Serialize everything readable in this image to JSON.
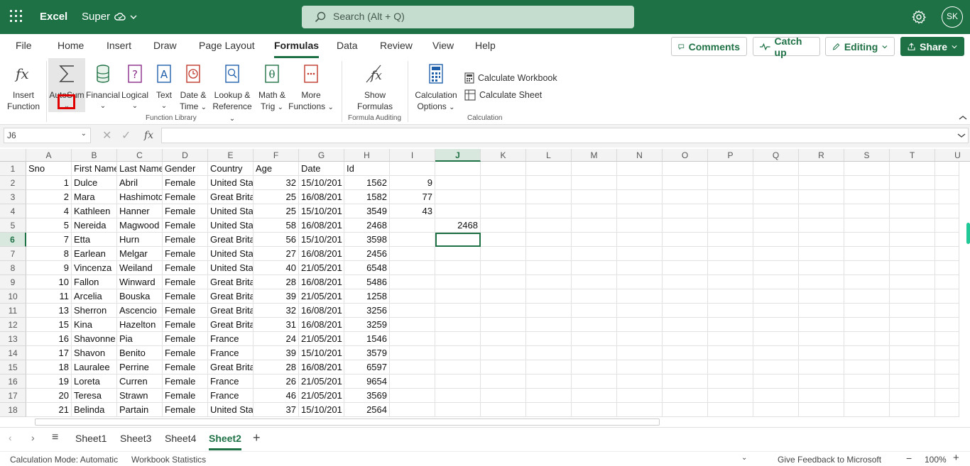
{
  "app": {
    "name": "Excel",
    "doc": "Super",
    "search_placeholder": "Search (Alt + Q)",
    "user": "SK"
  },
  "menu": [
    "File",
    "Home",
    "Insert",
    "Draw",
    "Page Layout",
    "Formulas",
    "Data",
    "Review",
    "View",
    "Help"
  ],
  "actions": {
    "comments": "Comments",
    "catchup": "Catch up",
    "editing": "Editing",
    "share": "Share"
  },
  "ribbon": {
    "insert_function": [
      "Insert",
      "Function"
    ],
    "autosum": "AutoSum",
    "financial": "Financial",
    "logical": "Logical",
    "text": "Text",
    "datetime": [
      "Date &",
      "Time"
    ],
    "lookup": [
      "Lookup &",
      "Reference"
    ],
    "math": [
      "Math &",
      "Trig"
    ],
    "more": [
      "More",
      "Functions"
    ],
    "show_formulas": [
      "Show",
      "Formulas"
    ],
    "calc_options": [
      "Calculation",
      "Options"
    ],
    "calc_workbook": "Calculate Workbook",
    "calc_sheet": "Calculate Sheet",
    "groups": {
      "function_library": "Function Library",
      "formula_auditing": "Formula Auditing",
      "calculation": "Calculation"
    }
  },
  "formula_bar": {
    "name_box": "J6",
    "formula": ""
  },
  "grid": {
    "columns": [
      "A",
      "B",
      "C",
      "D",
      "E",
      "F",
      "G",
      "H",
      "I",
      "J",
      "K",
      "L",
      "M",
      "N",
      "O",
      "P",
      "Q",
      "R",
      "S",
      "T",
      "U"
    ],
    "rows": [
      1,
      2,
      3,
      4,
      5,
      6,
      7,
      8,
      9,
      10,
      11,
      12,
      13,
      14,
      15,
      16,
      17,
      18
    ],
    "selected": "J6",
    "data": [
      [
        "Sno",
        "First Name",
        "Last Name",
        "Gender",
        "Country",
        "Age",
        "Date",
        "Id",
        "",
        ""
      ],
      [
        "1",
        "Dulce",
        "Abril",
        "Female",
        "United Sta",
        "32",
        "15/10/201",
        "1562",
        "9",
        ""
      ],
      [
        "2",
        "Mara",
        "Hashimoto",
        "Female",
        "Great Brita",
        "25",
        "16/08/201",
        "1582",
        "77",
        ""
      ],
      [
        "4",
        "Kathleen",
        "Hanner",
        "Female",
        "United Sta",
        "25",
        "15/10/201",
        "3549",
        "43",
        ""
      ],
      [
        "5",
        "Nereida",
        "Magwood",
        "Female",
        "United Sta",
        "58",
        "16/08/201",
        "2468",
        "",
        "2468"
      ],
      [
        "7",
        "Etta",
        "Hurn",
        "Female",
        "Great Brita",
        "56",
        "15/10/201",
        "3598",
        "",
        ""
      ],
      [
        "8",
        "Earlean",
        "Melgar",
        "Female",
        "United Sta",
        "27",
        "16/08/201",
        "2456",
        "",
        ""
      ],
      [
        "9",
        "Vincenza",
        "Weiland",
        "Female",
        "United Sta",
        "40",
        "21/05/201",
        "6548",
        "",
        ""
      ],
      [
        "10",
        "Fallon",
        "Winward",
        "Female",
        "Great Brita",
        "28",
        "16/08/201",
        "5486",
        "",
        ""
      ],
      [
        "11",
        "Arcelia",
        "Bouska",
        "Female",
        "Great Brita",
        "39",
        "21/05/201",
        "1258",
        "",
        ""
      ],
      [
        "13",
        "Sherron",
        "Ascencio",
        "Female",
        "Great Brita",
        "32",
        "16/08/201",
        "3256",
        "",
        ""
      ],
      [
        "15",
        "Kina",
        "Hazelton",
        "Female",
        "Great Brita",
        "31",
        "16/08/201",
        "3259",
        "",
        ""
      ],
      [
        "16",
        "Shavonne",
        "Pia",
        "Female",
        "France",
        "24",
        "21/05/201",
        "1546",
        "",
        ""
      ],
      [
        "17",
        "Shavon",
        "Benito",
        "Female",
        "France",
        "39",
        "15/10/201",
        "3579",
        "",
        ""
      ],
      [
        "18",
        "Lauralee",
        "Perrine",
        "Female",
        "Great Brita",
        "28",
        "16/08/201",
        "6597",
        "",
        ""
      ],
      [
        "19",
        "Loreta",
        "Curren",
        "Female",
        "France",
        "26",
        "21/05/201",
        "9654",
        "",
        ""
      ],
      [
        "20",
        "Teresa",
        "Strawn",
        "Female",
        "France",
        "46",
        "21/05/201",
        "3569",
        "",
        ""
      ],
      [
        "21",
        "Belinda",
        "Partain",
        "Female",
        "United Sta",
        "37",
        "15/10/201",
        "2564",
        "",
        ""
      ]
    ]
  },
  "sheets": [
    "Sheet1",
    "Sheet3",
    "Sheet4",
    "Sheet2"
  ],
  "active_sheet": "Sheet2",
  "status": {
    "calc_mode": "Calculation Mode: Automatic",
    "stats": "Workbook Statistics",
    "feedback": "Give Feedback to Microsoft",
    "zoom": "100%"
  },
  "colors": {
    "brand": "#1e7145",
    "highlight": "#e00000"
  }
}
